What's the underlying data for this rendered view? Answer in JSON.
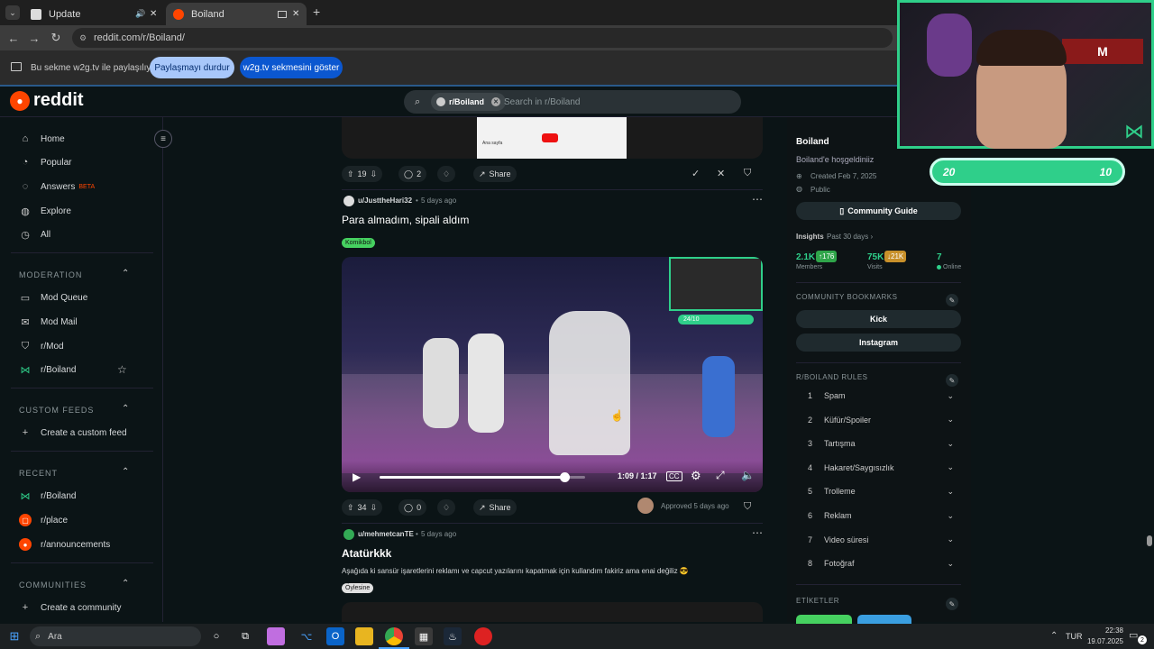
{
  "browser": {
    "tabs": [
      {
        "title": "Update"
      },
      {
        "title": "Boiland"
      }
    ],
    "url": "reddit.com/r/Boiland/",
    "share_bar": {
      "text": "Bu sekme w2g.tv ile paylaşılıyor",
      "stop_button": "Paylaşmayı durdur",
      "show_button": "w2g.tv sekmesini göster"
    }
  },
  "reddit": {
    "logo_text": "reddit",
    "search": {
      "chip": "r/Boiland",
      "placeholder": "Search in r/Boiland"
    }
  },
  "sidebar": {
    "main_items": [
      {
        "label": "Home",
        "icon": "home-icon"
      },
      {
        "label": "Popular",
        "icon": "popular-icon"
      },
      {
        "label": "Answers",
        "badge": "BETA",
        "icon": "answers-icon"
      },
      {
        "label": "Explore",
        "icon": "explore-icon"
      },
      {
        "label": "All",
        "icon": "all-icon"
      }
    ],
    "moderation_header": "MODERATION",
    "moderation_items": [
      {
        "label": "Mod Queue"
      },
      {
        "label": "Mod Mail"
      },
      {
        "label": "r/Mod"
      },
      {
        "label": "r/Boiland"
      }
    ],
    "custom_feeds_header": "CUSTOM FEEDS",
    "custom_feed_item": "Create a custom feed",
    "recent_header": "RECENT",
    "recent_items": [
      {
        "label": "r/Boiland"
      },
      {
        "label": "r/place"
      },
      {
        "label": "r/announcements"
      }
    ],
    "communities_header": "COMMUNITIES",
    "community_item": "Create a community"
  },
  "posts": {
    "top_post": {
      "upvotes": "19",
      "comments": "2",
      "share_label": "Share",
      "preview_text": "Ana sayfa"
    },
    "post1": {
      "author": "u/JusttheHari32",
      "time": "5 days ago",
      "title": "Para almadım, sipali aldım",
      "flair": "Komikbol",
      "video": {
        "time": "1:09 / 1:17",
        "progress": 0.9,
        "overlay_score": "24/10"
      },
      "upvotes": "34",
      "comments": "0",
      "share_label": "Share",
      "approved": "Approved 5 days ago"
    },
    "post2": {
      "author": "u/mehmetcanTE",
      "time": "5 days ago",
      "title": "Atatürkkk",
      "body": "Aşağıda ki sansür işaretlerini reklamı ve capcut yazılarını kapatmak için kullandım fakiriz ama enai değiliz 😎",
      "flair": "Öylesine"
    }
  },
  "community": {
    "name": "Boiland",
    "welcome": "Boiland'e hoşgeldiniiz",
    "created": "Created Feb 7, 2025",
    "visibility": "Public",
    "guide_button": "Community Guide",
    "insights_label": "Insights",
    "insights_period": "Past 30 days ›",
    "members": "2.1K",
    "members_delta": "↑176",
    "members_label": "Members",
    "visits": "75K",
    "visits_delta": "↓21K",
    "visits_label": "Visits",
    "online": "7",
    "online_label": "Online",
    "bookmarks_header": "COMMUNITY BOOKMARKS",
    "bookmarks": [
      "Kick",
      "Instagram"
    ],
    "rules_header": "R/BOILAND RULES",
    "rules": [
      {
        "num": "1",
        "label": "Spam"
      },
      {
        "num": "2",
        "label": "Küfür/Spoiler"
      },
      {
        "num": "3",
        "label": "Tartışma"
      },
      {
        "num": "4",
        "label": "Hakaret/Saygısızlık"
      },
      {
        "num": "5",
        "label": "Trolleme"
      },
      {
        "num": "6",
        "label": "Reklam"
      },
      {
        "num": "7",
        "label": "Video süresi"
      },
      {
        "num": "8",
        "label": "Fotoğraf"
      }
    ],
    "tags_header": "ETİKETLER"
  },
  "stream_overlay": {
    "score_left": "20",
    "score_right": "10"
  },
  "taskbar": {
    "search": "Ara",
    "lang": "TUR",
    "time": "22:38",
    "date": "19.07.2025",
    "notif": "2"
  },
  "colors": {
    "reddit_orange": "#ff4500",
    "accent_green": "#2fcf8a",
    "share_stop": "#a8c7fa",
    "share_show": "#0b57d0"
  }
}
